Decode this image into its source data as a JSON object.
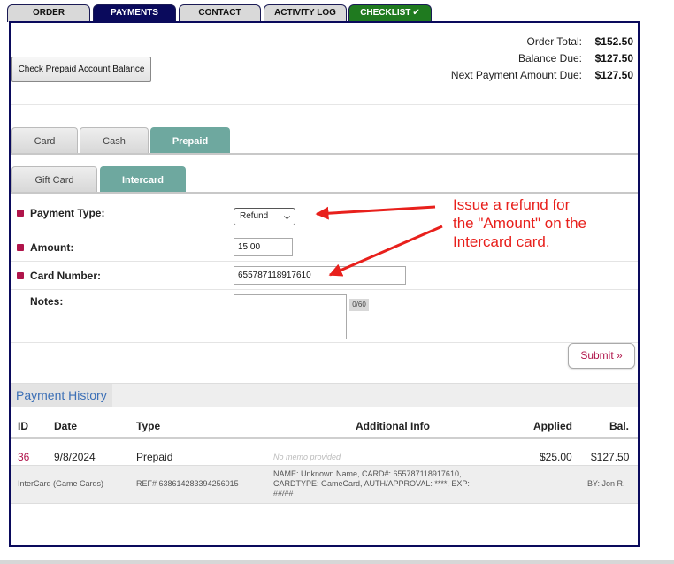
{
  "top_tabs": [
    {
      "label": "ORDER",
      "state": "inactive"
    },
    {
      "label": "PAYMENTS",
      "state": "active"
    },
    {
      "label": "CONTACT",
      "state": "inactive"
    },
    {
      "label": "ACTIVITY LOG",
      "state": "inactive"
    },
    {
      "label": "CHECKLIST",
      "state": "complete",
      "icon": "check-icon"
    }
  ],
  "actions": {
    "check_prepaid_label": "Check Prepaid Account Balance",
    "submit_label": "Submit »"
  },
  "totals": {
    "order_total_label": "Order Total:",
    "order_total": "$152.50",
    "balance_due_label": "Balance Due:",
    "balance_due": "$127.50",
    "next_payment_label": "Next Payment Amount Due:",
    "next_payment": "$127.50"
  },
  "payment_method_tabs": [
    {
      "label": "Card",
      "active": false
    },
    {
      "label": "Cash",
      "active": false
    },
    {
      "label": "Prepaid",
      "active": true
    }
  ],
  "prepaid_tabs": [
    {
      "label": "Gift Card",
      "active": false
    },
    {
      "label": "Intercard",
      "active": true
    }
  ],
  "form": {
    "payment_type_label": "Payment Type:",
    "payment_type_value": "Refund",
    "amount_label": "Amount:",
    "amount_value": "15.00",
    "card_number_label": "Card Number:",
    "card_number_value": "655787118917610",
    "notes_label": "Notes:",
    "notes_counter": "0/60"
  },
  "annotation": {
    "lines": [
      "Issue a refund for",
      "the \"Amount\" on the",
      "Intercard card."
    ],
    "color": "#e8201c"
  },
  "history": {
    "title": "Payment History",
    "columns": [
      "ID",
      "Date",
      "Type",
      "Additional Info",
      "Applied",
      "Bal."
    ],
    "rows": [
      {
        "id": "36",
        "date": "9/8/2024",
        "type": "Prepaid",
        "memo": "No memo provided",
        "applied": "$25.00",
        "balance": "$127.50",
        "method": "InterCard (Game Cards)",
        "ref": "REF# 638614283394256015",
        "info_line1": "NAME: Unknown Name, CARD#: 655787118917610,",
        "info_line2": "CARDTYPE: GameCard, AUTH/APPROVAL: ****, EXP:",
        "info_line3": "##/##",
        "by": "BY: Jon R."
      }
    ]
  },
  "colors": {
    "navy": "#0a0a5c",
    "teal": "#6ea89f",
    "required": "#b0144a",
    "checklist_green": "#1f7a1f",
    "link_blue": "#3b6fb6"
  }
}
